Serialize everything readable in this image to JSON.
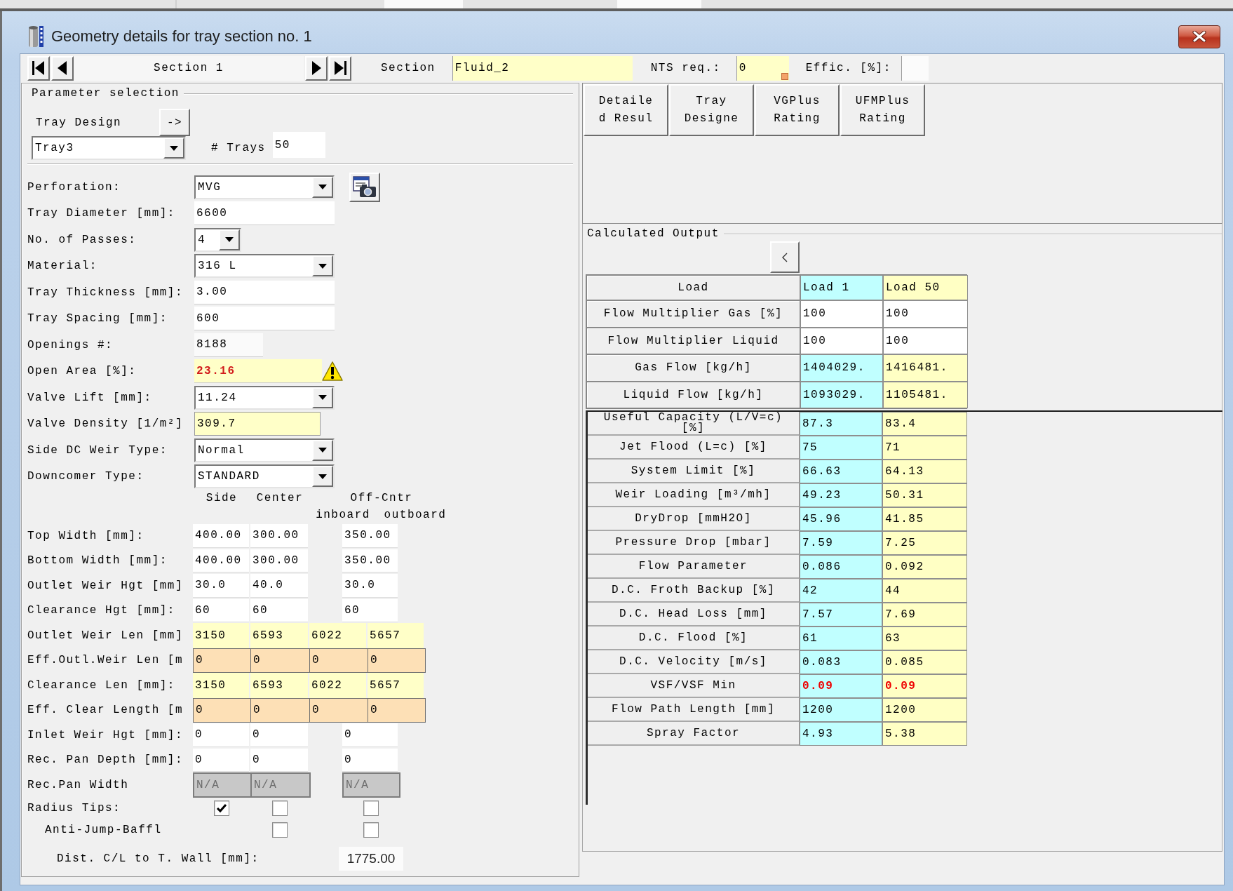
{
  "window": {
    "title": "Geometry details for tray section no. 1"
  },
  "toolbar": {
    "section_name": "Section 1",
    "section": {
      "label": "Section",
      "value": "Fluid_2"
    },
    "nts_req": {
      "label": "NTS req.:",
      "value": "0",
      "flagged": true
    },
    "effic": {
      "label": "Effic. [%]:"
    }
  },
  "parameter_selection": {
    "title": "Parameter selection",
    "tray_design": {
      "label": "Tray Design",
      "button": "->",
      "value": "Tray3"
    },
    "trays": {
      "label": "# Trays",
      "value": "50"
    }
  },
  "form": [
    {
      "label": "Perforation:",
      "kind": "dropdown",
      "value": "MVG",
      "warning": false,
      "tool_button": true
    },
    {
      "label": "Tray Diameter [mm]:",
      "kind": "input",
      "value": "6600",
      "warning": false,
      "tool_button": false
    },
    {
      "label": "No. of Passes:",
      "kind": "dropdown_small",
      "value": "4",
      "warning": false,
      "tool_button": false
    },
    {
      "label": "Material:",
      "kind": "dropdown",
      "value": "316 L",
      "warning": false,
      "tool_button": false
    },
    {
      "label": "Tray Thickness [mm]:",
      "kind": "input",
      "value": "3.00",
      "warning": false,
      "tool_button": false
    },
    {
      "label": "Tray Spacing [mm]:",
      "kind": "input",
      "value": "600",
      "warning": false,
      "tool_button": false
    },
    {
      "label": "Openings #:",
      "kind": "readonly",
      "value": "8188",
      "warning": false,
      "tool_button": false
    },
    {
      "label": "Open Area [%]:",
      "kind": "calculated",
      "value": "23.16",
      "warning": true,
      "tool_button": false
    },
    {
      "label": "Valve Lift [mm]:",
      "kind": "dropdown",
      "value": "11.24",
      "warning": false,
      "tool_button": false
    },
    {
      "label": "Valve Density [1/m²]",
      "kind": "calculated_boxed",
      "value": "309.7",
      "warning": false,
      "tool_button": false
    },
    {
      "label": "Side DC Weir Type:",
      "kind": "dropdown",
      "value": "Normal",
      "warning": false,
      "tool_button": false
    },
    {
      "label": "Downcomer Type:",
      "kind": "dropdown",
      "value": "STANDARD",
      "warning": false,
      "tool_button": false
    }
  ],
  "grid": {
    "headers": {
      "side": "Side",
      "center": "Center",
      "off_cntr": "Off-Cntr",
      "inboard": "inboard",
      "outboard": "outboard"
    },
    "rows": [
      {
        "label": "Top Width [mm]:",
        "kind": "input",
        "values": [
          "400.00",
          "300.00",
          "350.00"
        ]
      },
      {
        "label": "Bottom Width [mm]:",
        "kind": "input",
        "values": [
          "400.00",
          "300.00",
          "350.00"
        ]
      },
      {
        "label": "Outlet Weir Hgt [mm]",
        "kind": "input",
        "values": [
          "30.0",
          "40.0",
          "30.0"
        ]
      },
      {
        "label": "Clearance Hgt [mm]:",
        "kind": "input",
        "values": [
          "60",
          "60",
          "60"
        ]
      },
      {
        "label": "Outlet Weir Len [mm]",
        "kind": "calculated",
        "values": [
          "3150",
          "6593",
          "6022",
          "5657"
        ]
      },
      {
        "label": "Eff.Outl.Weir Len [m",
        "kind": "effective",
        "values": [
          "0",
          "0",
          "0",
          "0"
        ]
      },
      {
        "label": "Clearance Len [mm]:",
        "kind": "calculated",
        "values": [
          "3150",
          "6593",
          "6022",
          "5657"
        ]
      },
      {
        "label": "Eff. Clear Length [m",
        "kind": "effective",
        "values": [
          "0",
          "0",
          "0",
          "0"
        ]
      },
      {
        "label": "Inlet Weir Hgt [mm]:",
        "kind": "input",
        "values": [
          "0",
          "0",
          "0"
        ]
      },
      {
        "label": "Rec. Pan Depth [mm]:",
        "kind": "input",
        "values": [
          "0",
          "0",
          "0"
        ]
      },
      {
        "label": "Rec.Pan Width",
        "kind": "unavailable",
        "values": [
          "N/A",
          "N/A",
          "N/A"
        ]
      },
      {
        "label": "Radius Tips:",
        "kind": "checkbox",
        "checks": {
          "side": {
            "checked": true
          },
          "center": {
            "checked": false
          },
          "off_cntr": {
            "checked": false
          }
        }
      },
      {
        "label": "Anti-Jump-Baffl",
        "kind": "sub_checkbox",
        "checks": {
          "center": {
            "checked": false
          },
          "off_cntr": {
            "checked": false
          }
        }
      }
    ]
  },
  "dist": {
    "label": "Dist. C/L to T. Wall [mm]:",
    "value": "1775.00"
  },
  "design_buttons": [
    "Detailed Resul",
    "Tray Designe",
    "VGPlus Rating",
    "UFMPlus Rating"
  ],
  "calculated_output": {
    "title": "Calculated Output",
    "columns": [
      {
        "label": "Load"
      },
      {
        "label": "Load 1",
        "color": "#c0ffff"
      },
      {
        "label": "Load 50",
        "color": "#ffffc4"
      }
    ],
    "input_rows": [
      {
        "label": "Flow Multiplier Gas [%]",
        "kind": "multiplier",
        "values": [
          "100",
          "100"
        ]
      },
      {
        "label": "Flow Multiplier Liquid",
        "kind": "multiplier",
        "values": [
          "100",
          "100"
        ]
      },
      {
        "label": "Gas Flow [kg/h]",
        "kind": "flow",
        "values": [
          "1404029.",
          "1416481."
        ]
      },
      {
        "label": "Liquid Flow [kg/h]",
        "kind": "flow",
        "values": [
          "1093029.",
          "1105481."
        ]
      }
    ],
    "result_rows": [
      {
        "label": "Useful Capacity (L/V=c) [%]",
        "values": [
          "87.3",
          "83.4"
        ],
        "alert": false
      },
      {
        "label": "Jet Flood (L=c) [%]",
        "values": [
          "75",
          "71"
        ],
        "alert": false
      },
      {
        "label": "System Limit [%]",
        "values": [
          "66.63",
          "64.13"
        ],
        "alert": false
      },
      {
        "label": "Weir Loading [m³/mh]",
        "values": [
          "49.23",
          "50.31"
        ],
        "alert": false
      },
      {
        "label": "DryDrop [mmH2O]",
        "values": [
          "45.96",
          "41.85"
        ],
        "alert": false
      },
      {
        "label": "Pressure Drop [mbar]",
        "values": [
          "7.59",
          "7.25"
        ],
        "alert": false
      },
      {
        "label": "Flow Parameter",
        "values": [
          "0.086",
          "0.092"
        ],
        "alert": false
      },
      {
        "label": "D.C. Froth Backup [%]",
        "values": [
          "42",
          "44"
        ],
        "alert": false
      },
      {
        "label": "D.C. Head Loss [mm]",
        "values": [
          "7.57",
          "7.69"
        ],
        "alert": false
      },
      {
        "label": "D.C. Flood [%]",
        "values": [
          "61",
          "63"
        ],
        "alert": false
      },
      {
        "label": "D.C. Velocity [m/s]",
        "values": [
          "0.083",
          "0.085"
        ],
        "alert": false
      },
      {
        "label": "VSF/VSF Min",
        "values": [
          "0.09",
          "0.09"
        ],
        "alert": true
      },
      {
        "label": "Flow Path Length [mm]",
        "values": [
          "1200",
          "1200"
        ],
        "alert": false
      },
      {
        "label": "Spray Factor",
        "values": [
          "4.93",
          "5.38"
        ],
        "alert": false
      }
    ]
  }
}
